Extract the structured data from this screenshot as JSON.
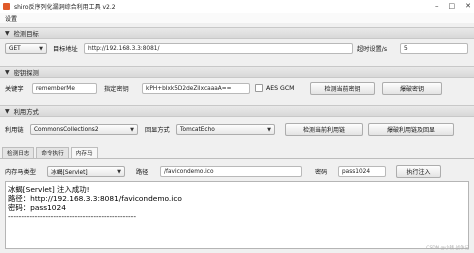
{
  "window": {
    "title": "shiro反序列化漏洞综合利用工具 v2.2"
  },
  "menu": {
    "settings": "设置"
  },
  "detect_section": {
    "title": "检测目标",
    "method": "GET",
    "target_label": "目标地址",
    "target_value": "http://192.168.3.3:8081/",
    "timeout_label": "超时设置/s",
    "timeout_value": "5"
  },
  "key_section": {
    "title": "密钥探测",
    "keyword_label": "关键字",
    "keyword_value": "rememberMe",
    "key_label": "指定密钥",
    "key_value": "kPH+bIxk5D2deZiIxcaaaA==",
    "aes_gcm_label": "AES GCM",
    "aes_gcm_checked": false,
    "detect_key_btn": "检测当前密钥",
    "brute_key_btn": "爆破密钥"
  },
  "exploit_section": {
    "title": "利用方式",
    "chain_label": "利用链",
    "chain_value": "CommonsCollections2",
    "echo_label": "回显方式",
    "echo_value": "TomcatEcho",
    "detect_chain_btn": "检测当前利用链",
    "brute_chain_btn": "爆破利用链及回显"
  },
  "tabs": [
    {
      "label": "检测日志"
    },
    {
      "label": "命令执行"
    },
    {
      "label": "内存马"
    }
  ],
  "memshell": {
    "type_label": "内存马类型",
    "type_value": "冰蝎[Servlet]",
    "path_label": "路径",
    "path_value": "/favicondemo.ico",
    "password_label": "密码",
    "password_value": "pass1024",
    "inject_btn": "执行注入"
  },
  "output_lines": [
    "冰蝎[Servlet] 注入成功!",
    "路径：http://192.168.3.3:8081/favicondemo.ico",
    "密码：pass1024",
    "------------------------------------------------"
  ],
  "watermark": "CSDN @小钱 战争记"
}
